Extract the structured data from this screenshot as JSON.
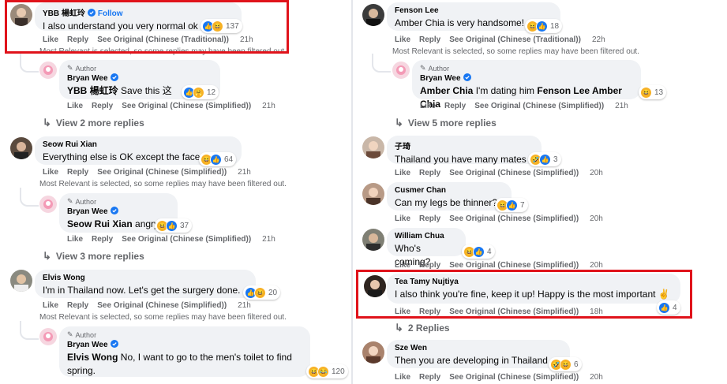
{
  "colors": {
    "accent": "#1877f2",
    "highlight": "#e0131b",
    "bubble": "#f0f2f5",
    "meta": "#65676b"
  },
  "actions": {
    "like": "Like",
    "reply": "Reply"
  },
  "left": [
    {
      "name": "YBB 楊虹玲",
      "follow": "Follow",
      "text": "I also understand you very normal ok",
      "reactions": "137",
      "see": "See Original (Chinese (Traditional))",
      "time": "21h",
      "note": "Most Relevant is selected, so some replies may have been filtered out."
    },
    {
      "author": "Author",
      "name": "Bryan Wee",
      "mention": "YBB 楊虹玲",
      "text": "Save this 这",
      "reactions": "12",
      "see": "See Original (Chinese (Simplified))",
      "time": "21h"
    },
    {
      "more": "View 2 more replies"
    },
    {
      "name": "Seow Rui Xian",
      "text": "Everything else is OK except the face",
      "reactions": "64",
      "see": "See Original (Chinese (Simplified))",
      "time": "21h",
      "note": "Most Relevant is selected, so some replies may have been filtered out."
    },
    {
      "author": "Author",
      "name": "Bryan Wee",
      "mention": "Seow Rui Xian",
      "text": "angry",
      "reactions": "37",
      "see": "See Original (Chinese (Simplified))",
      "time": "21h"
    },
    {
      "more": "View 3 more replies"
    },
    {
      "name": "Elvis Wong",
      "text": "I'm in Thailand now. Let's get the surgery done.",
      "reactions": "20",
      "see": "See Original (Chinese (Simplified))",
      "time": "21h",
      "note": "Most Relevant is selected, so some replies may have been filtered out."
    },
    {
      "author": "Author",
      "name": "Bryan Wee",
      "mention": "Elvis Wong",
      "text": "No, I want to go to the men's toilet to find",
      "text2": "spring.",
      "reactions": "120"
    }
  ],
  "right": [
    {
      "name": "Fenson Lee",
      "text": "Amber Chia is very handsome!",
      "reactions": "18",
      "see": "See Original (Chinese (Traditional))",
      "time": "22h",
      "note": "Most Relevant is selected, so some replies may have been filtered out."
    },
    {
      "author": "Author",
      "name": "Bryan Wee",
      "mention": "Amber Chia",
      "text": "I'm dating him",
      "mention2": "Fenson Lee Amber Chia",
      "reactions": "13",
      "see": "See Original (Chinese (Simplified))",
      "time": "21h"
    },
    {
      "more": "View 5 more replies"
    },
    {
      "name": "子琦",
      "text": "Thailand you have many mates",
      "reactions": "3",
      "see": "See Original (Chinese (Simplified))",
      "time": "20h"
    },
    {
      "name": "Cusmer Chan",
      "text": "Can my legs be thinner?",
      "reactions": "7",
      "see": "See Original (Chinese (Simplified))",
      "time": "20h"
    },
    {
      "name": "William Chua",
      "text": "Who's coming?",
      "reactions": "4",
      "see": "See Original (Chinese (Simplified))",
      "time": "20h"
    },
    {
      "name": "Tea Tamy Nujtiya",
      "text": "I also think you're fine, keep it up! Happy is the most important",
      "reactions": "4",
      "see": "See Original (Chinese (Simplified))",
      "time": "18h"
    },
    {
      "more": "2 Replies"
    },
    {
      "name": "Sze Wen",
      "text": "Then you are developing in Thailand",
      "reactions": "6",
      "see": "See Original (Chinese (Simplified))",
      "time": "20h"
    }
  ]
}
